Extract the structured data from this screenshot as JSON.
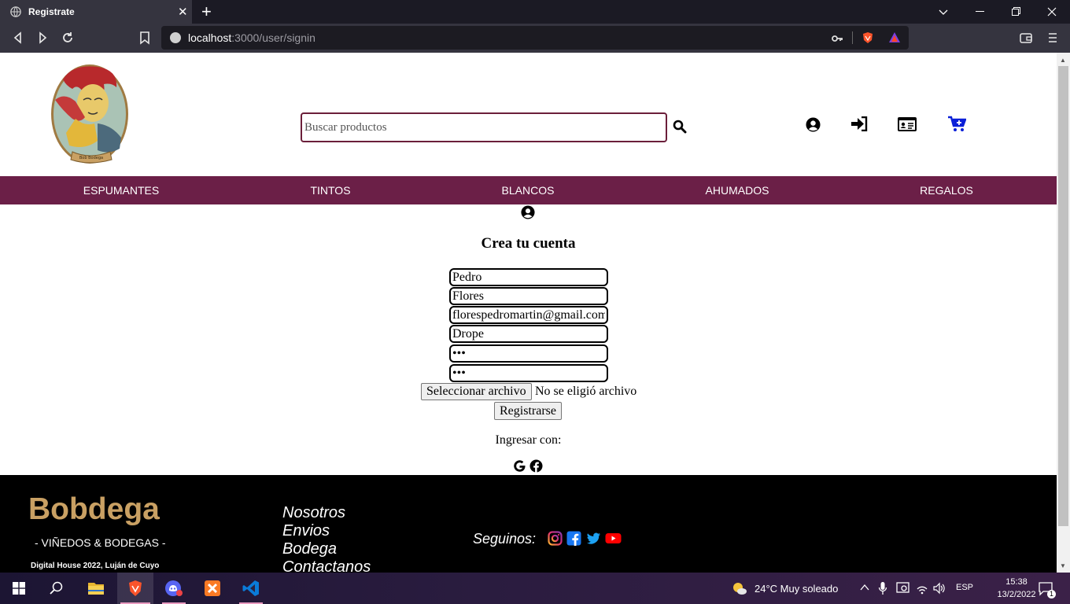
{
  "browser": {
    "tab_title": "Registrate",
    "url_host": "localhost",
    "url_path": ":3000/user/signin"
  },
  "header": {
    "search_placeholder": "Buscar productos"
  },
  "categories": [
    "ESPUMANTES",
    "TINTOS",
    "BLANCOS",
    "AHUMADOS",
    "REGALOS"
  ],
  "form": {
    "title": "Crea tu cuenta",
    "first_name": "Pedro",
    "last_name": "Flores",
    "email": "florespedromartin@gmail.com",
    "username": "Drope",
    "password": "•••",
    "password_confirm": "•••",
    "file_button": "Seleccionar archivo",
    "file_status": "No se eligió archivo",
    "submit": "Registrarse",
    "login_with": "Ingresar con:"
  },
  "footer": {
    "brand": "Bobdega",
    "tagline": "- VIÑEDOS & BODEGAS -",
    "copyright": "Digital House 2022, Luján de Cuyo",
    "links": [
      "Nosotros",
      "Envios",
      "Bodega",
      "Contactanos"
    ],
    "follow_label": "Seguinos:"
  },
  "taskbar": {
    "weather": "24°C  Muy soleado",
    "language": "ESP",
    "time": "15:38",
    "date": "13/2/2022",
    "notifications": "1"
  },
  "colors": {
    "nav_bg": "#6b1f47",
    "brand": "#c9a063",
    "cart": "#0a1fd8"
  }
}
